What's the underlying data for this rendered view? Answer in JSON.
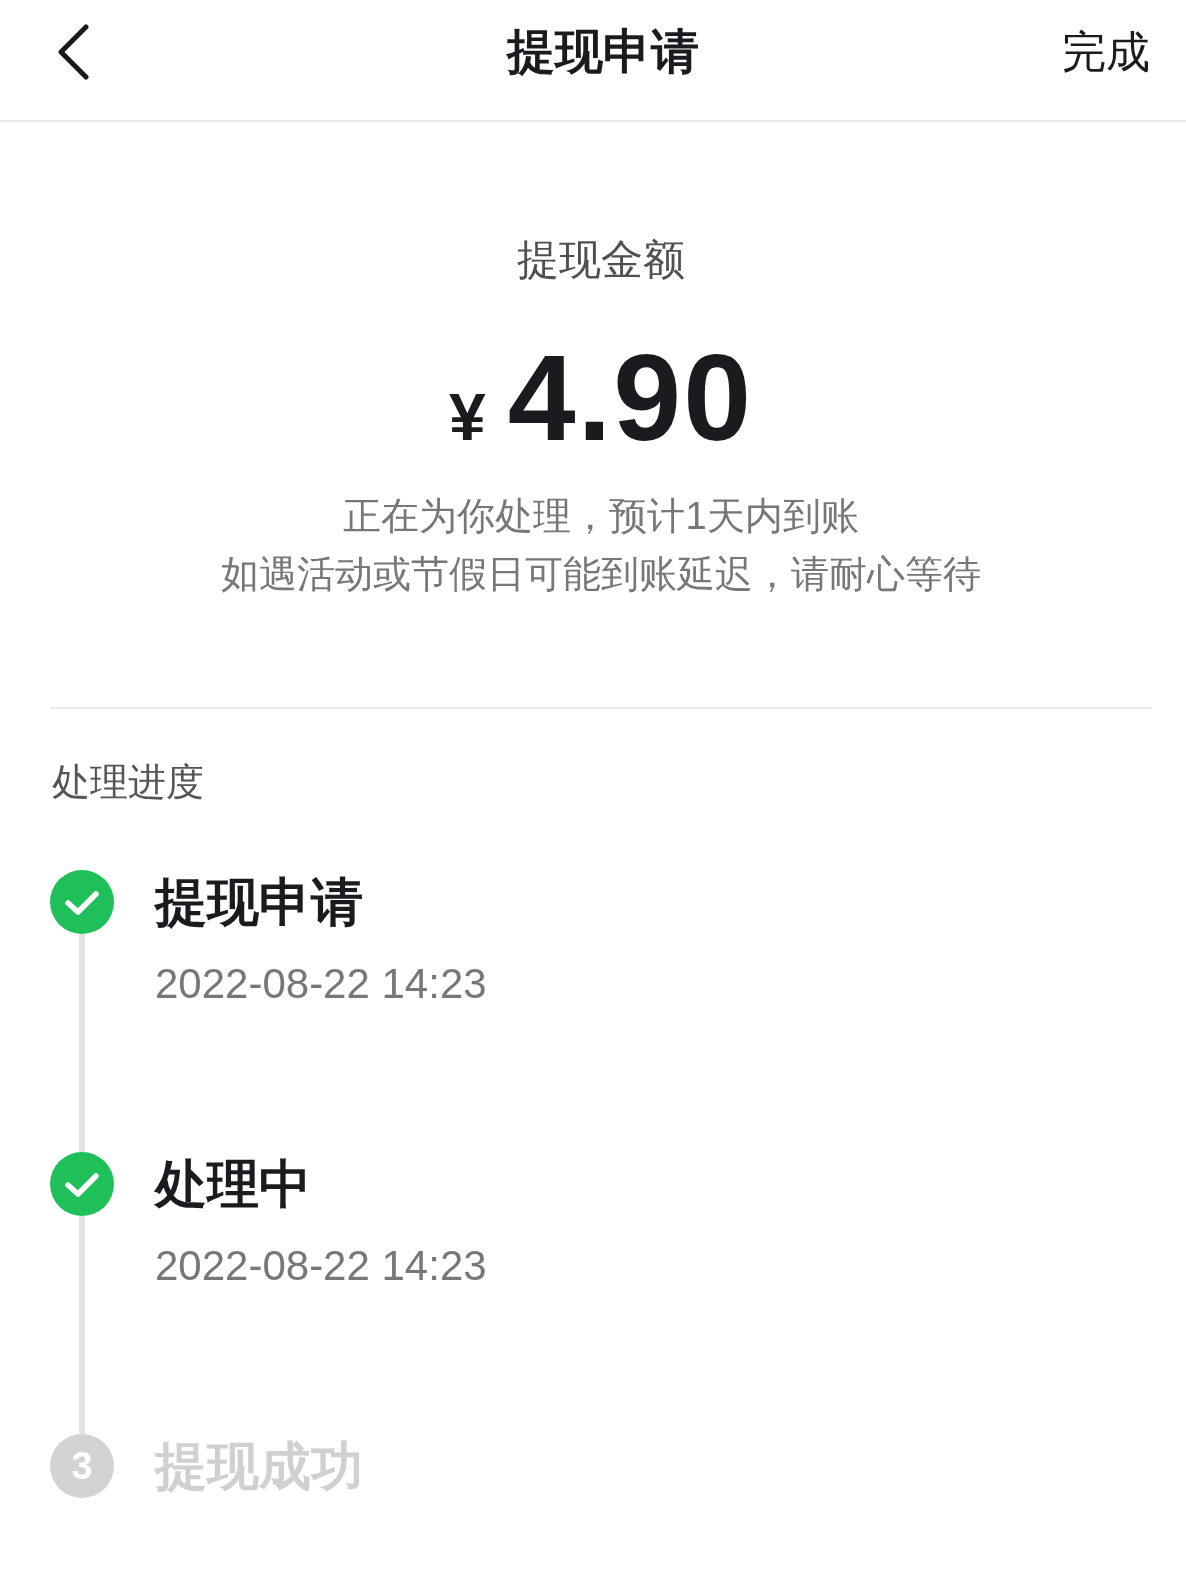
{
  "header": {
    "title": "提现申请",
    "action": "完成"
  },
  "amount": {
    "label": "提现金额",
    "currency": "¥",
    "value": "4.90",
    "notes": [
      "正在为你处理，预计1天内到账",
      "如遇活动或节假日可能到账延迟，请耐心等待"
    ]
  },
  "progress": {
    "title": "处理进度",
    "steps": [
      {
        "title": "提现申请",
        "time": "2022-08-22 14:23",
        "done": true
      },
      {
        "title": "处理中",
        "time": "2022-08-22 14:23",
        "done": true
      },
      {
        "title": "提现成功",
        "number": "3",
        "done": false
      }
    ]
  }
}
